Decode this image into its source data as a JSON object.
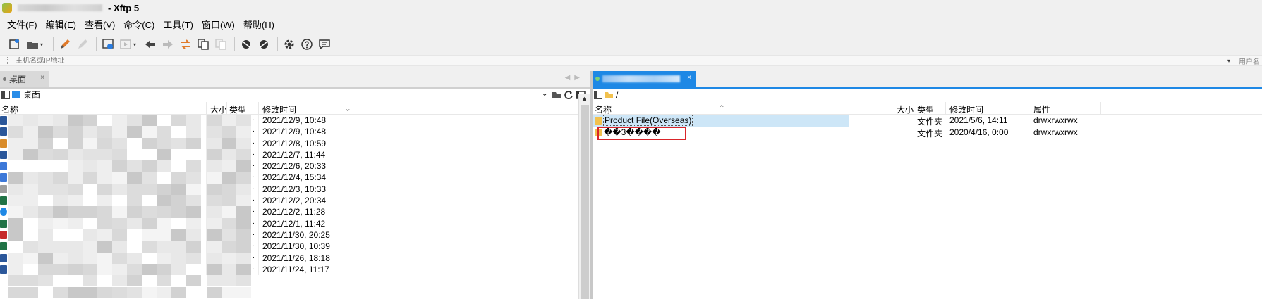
{
  "window": {
    "title": "- Xftp 5"
  },
  "menu": [
    "文件(F)",
    "编辑(E)",
    "查看(V)",
    "命令(C)",
    "工具(T)",
    "窗口(W)",
    "帮助(H)"
  ],
  "toolbar": {
    "icons": [
      "new-session-icon",
      "open-folder-icon",
      "dropdown-icon",
      "edit-icon",
      "disabled-edit-icon",
      "properties-icon",
      "play-icon",
      "back-icon",
      "forward-icon",
      "transfer-icon",
      "copy-icon",
      "paste-icon",
      "xshell-icon",
      "xshell-alt-icon",
      "settings-icon",
      "help-icon",
      "chat-icon"
    ]
  },
  "address": {
    "placeholder": "主机名或IP地址",
    "user_label": "用户名"
  },
  "left_panel": {
    "tab_label": "桌面",
    "path": "桌面",
    "columns": {
      "name": "名称",
      "size": "大小",
      "type": "类型",
      "mtime": "修改时间"
    },
    "rows": [
      {
        "date": "2021/12/9, 10:48",
        "icon": "word-doc-icon"
      },
      {
        "date": "2021/12/9, 10:48",
        "icon": "word-doc-icon"
      },
      {
        "date": "2021/12/8, 10:59",
        "icon": "image-file-icon"
      },
      {
        "date": "2021/12/7, 11:44",
        "icon": "word-doc-icon"
      },
      {
        "date": "2021/12/6, 20:33",
        "icon": "document-icon"
      },
      {
        "date": "2021/12/4, 15:34",
        "icon": "document-icon"
      },
      {
        "date": "2021/12/3, 10:33",
        "icon": "text-file-icon"
      },
      {
        "date": "2021/12/2, 20:34",
        "icon": "excel-file-icon"
      },
      {
        "date": "2021/12/2, 11:28",
        "icon": "shortcut-icon"
      },
      {
        "date": "2021/12/1, 11:42",
        "icon": "excel-file-icon"
      },
      {
        "date": "2021/11/30, 20:25",
        "icon": "app-icon"
      },
      {
        "date": "2021/11/30, 10:39",
        "icon": "excel-file-icon"
      },
      {
        "date": "2021/11/26, 18:18",
        "icon": "word-doc-icon"
      },
      {
        "date": "2021/11/24, 11:17",
        "icon": "word-doc-icon"
      }
    ]
  },
  "right_panel": {
    "path": "/",
    "columns": {
      "name": "名称",
      "size": "大小",
      "type": "类型",
      "mtime": "修改时间",
      "attr": "属性"
    },
    "rows": [
      {
        "name": "Product File(Overseas)",
        "type": "文件夹",
        "mtime": "2021/5/6, 14:11",
        "attr": "drwxrwxrwx"
      },
      {
        "name": "��3����",
        "type": "文件夹",
        "mtime": "2020/4/16, 0:00",
        "attr": "drwxrwxrwx"
      }
    ]
  },
  "colors": {
    "active_tab": "#1e88e5",
    "selection": "#cde6f7",
    "highlight_border": "#d9252a"
  }
}
